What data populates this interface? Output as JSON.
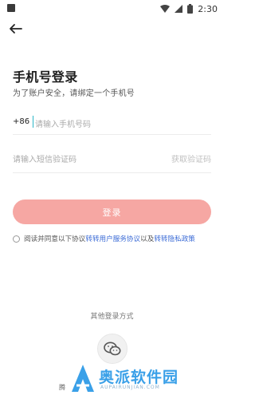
{
  "status_bar": {
    "time": "2:30"
  },
  "header": {
    "title": "手机号登录",
    "subtitle": "为了账户安全，请绑定一个手机号"
  },
  "phone": {
    "country_code": "+86",
    "placeholder": "请输入手机号码"
  },
  "code": {
    "placeholder": "请输入短信验证码",
    "get_code_label": "获取验证码"
  },
  "login_button": {
    "label": "登录"
  },
  "agreement": {
    "prefix": "阅读并同意以下协议",
    "link1": "转转用户服务协议",
    "middle": "以及",
    "link2": "转转隐私政策"
  },
  "other_login": {
    "label": "其他登录方式"
  },
  "footer": {
    "partial_text": "腾"
  },
  "watermark": {
    "text": "奥派软件园",
    "sub": "AUPAIRUNJIAN.COM"
  },
  "colors": {
    "accent": "#f6a7a3",
    "link": "#3b6bd6",
    "watermark": "#3aa0e8"
  }
}
